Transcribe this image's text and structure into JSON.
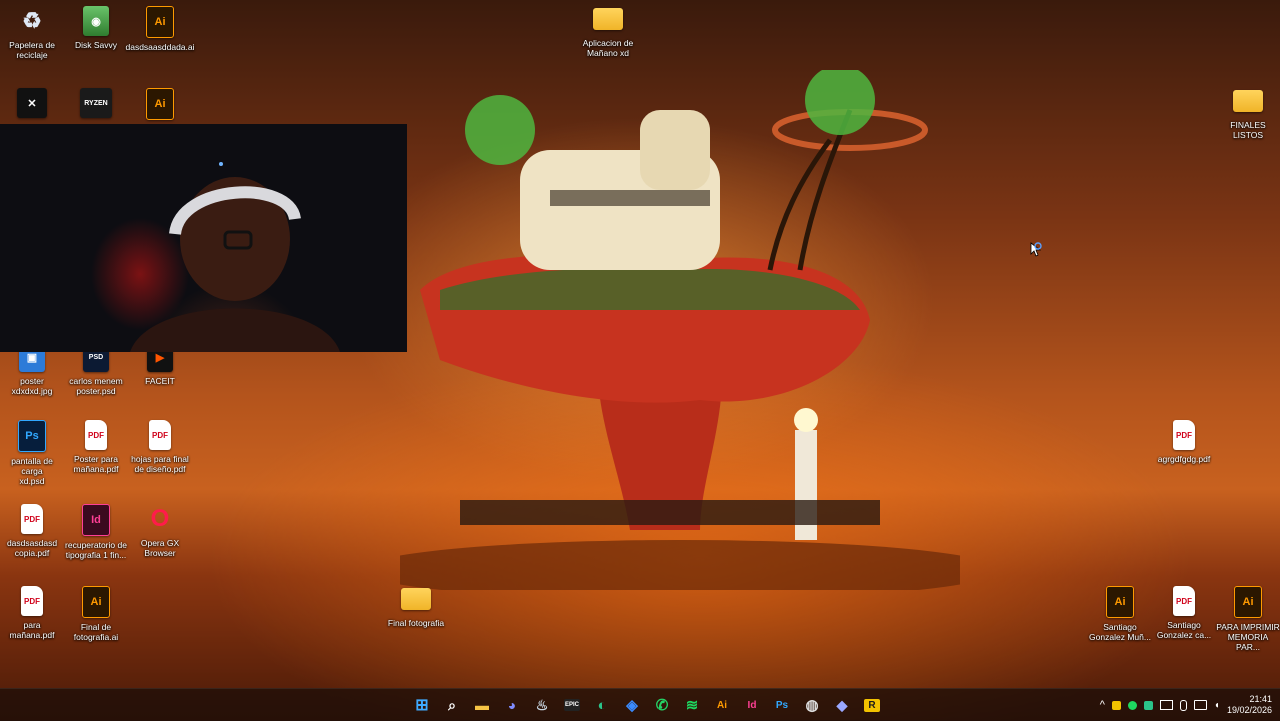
{
  "desktop": {
    "icons": [
      {
        "label": "Papelera de\nreciclaje",
        "glyph": "♻",
        "kind": "recycle"
      },
      {
        "label": "Disk Savvy",
        "glyph": "◉",
        "kind": "app"
      },
      {
        "label": "dasdsaasddada.ai",
        "glyph": "Ai",
        "kind": "ai"
      },
      {
        "label": "Aplicacion de\nMañano xd",
        "glyph": "",
        "kind": "folder"
      },
      {
        "label": "FINALES LISTOS",
        "glyph": "",
        "kind": "folder"
      },
      {
        "label": "",
        "glyph": "✕",
        "kind": "app"
      },
      {
        "label": "",
        "glyph": "RYZEN",
        "kind": "app"
      },
      {
        "label": "",
        "glyph": "Ai",
        "kind": "ai"
      },
      {
        "label": "poster\nxdxdxd.jpg",
        "glyph": "▣",
        "kind": "app"
      },
      {
        "label": "carlos menem\nposter.psd",
        "glyph": "PSD",
        "kind": "app"
      },
      {
        "label": "FACEIT",
        "glyph": "▶",
        "kind": "app"
      },
      {
        "label": "pantalla de carga\nxd.psd",
        "glyph": "Ps",
        "kind": "ps"
      },
      {
        "label": "Poster para\nmañana.pdf",
        "glyph": "PDF",
        "kind": "pdf"
      },
      {
        "label": "hojas para final\nde diseño.pdf",
        "glyph": "PDF",
        "kind": "pdf"
      },
      {
        "label": "agrgdfgdg.pdf",
        "glyph": "PDF",
        "kind": "pdf"
      },
      {
        "label": "dasdsasdasd\ncopia.pdf",
        "glyph": "PDF",
        "kind": "pdf"
      },
      {
        "label": "recuperatorio de\ntipografia 1 fin...",
        "glyph": "Id",
        "kind": "id"
      },
      {
        "label": "Opera GX\nBrowser",
        "glyph": "O",
        "kind": "app"
      },
      {
        "label": "para mañana.pdf",
        "glyph": "PDF",
        "kind": "pdf"
      },
      {
        "label": "Final de\nfotografia.ai",
        "glyph": "Ai",
        "kind": "ai"
      },
      {
        "label": "Final fotografia",
        "glyph": "",
        "kind": "folder"
      },
      {
        "label": "Santiago\nGonzalez Muñ...",
        "glyph": "Ai",
        "kind": "ai"
      },
      {
        "label": "Santiago\nGonzalez ca...",
        "glyph": "PDF",
        "kind": "pdf"
      },
      {
        "label": "PARA IMPRIMIR\nMEMORIA PAR...",
        "glyph": "Ai",
        "kind": "ai"
      }
    ]
  },
  "taskbar": {
    "apps": [
      {
        "name": "start",
        "glyph": "⊞",
        "color": "#3fa9ff"
      },
      {
        "name": "search",
        "glyph": "⌕",
        "color": "#ffffff"
      },
      {
        "name": "file-explorer",
        "glyph": "▬",
        "color": "#f6c445"
      },
      {
        "name": "discord",
        "glyph": "◕",
        "color": "#7f8cff"
      },
      {
        "name": "steam",
        "glyph": "♨",
        "color": "#c7d5e0"
      },
      {
        "name": "epic-games",
        "glyph": "EPIC",
        "color": "#ffffff"
      },
      {
        "name": "edge",
        "glyph": "◐",
        "color": "#2bc48a"
      },
      {
        "name": "browser",
        "glyph": "◈",
        "color": "#3a8bff"
      },
      {
        "name": "whatsapp",
        "glyph": "✆",
        "color": "#25d366"
      },
      {
        "name": "spotify",
        "glyph": "≋",
        "color": "#1ed760"
      },
      {
        "name": "illustrator",
        "glyph": "Ai",
        "color": "#ff9a00"
      },
      {
        "name": "indesign",
        "glyph": "Id",
        "color": "#ff3f95"
      },
      {
        "name": "photoshop",
        "glyph": "Ps",
        "color": "#31a8ff"
      },
      {
        "name": "obs",
        "glyph": "◍",
        "color": "#dddddd"
      },
      {
        "name": "app-diamond",
        "glyph": "◆",
        "color": "#9aa8ff"
      },
      {
        "name": "app-r",
        "glyph": "R",
        "color": "#f2c200"
      }
    ],
    "tray": {
      "chevron": "^",
      "clock_time": "21:41",
      "clock_date": "19/02/2026"
    }
  }
}
